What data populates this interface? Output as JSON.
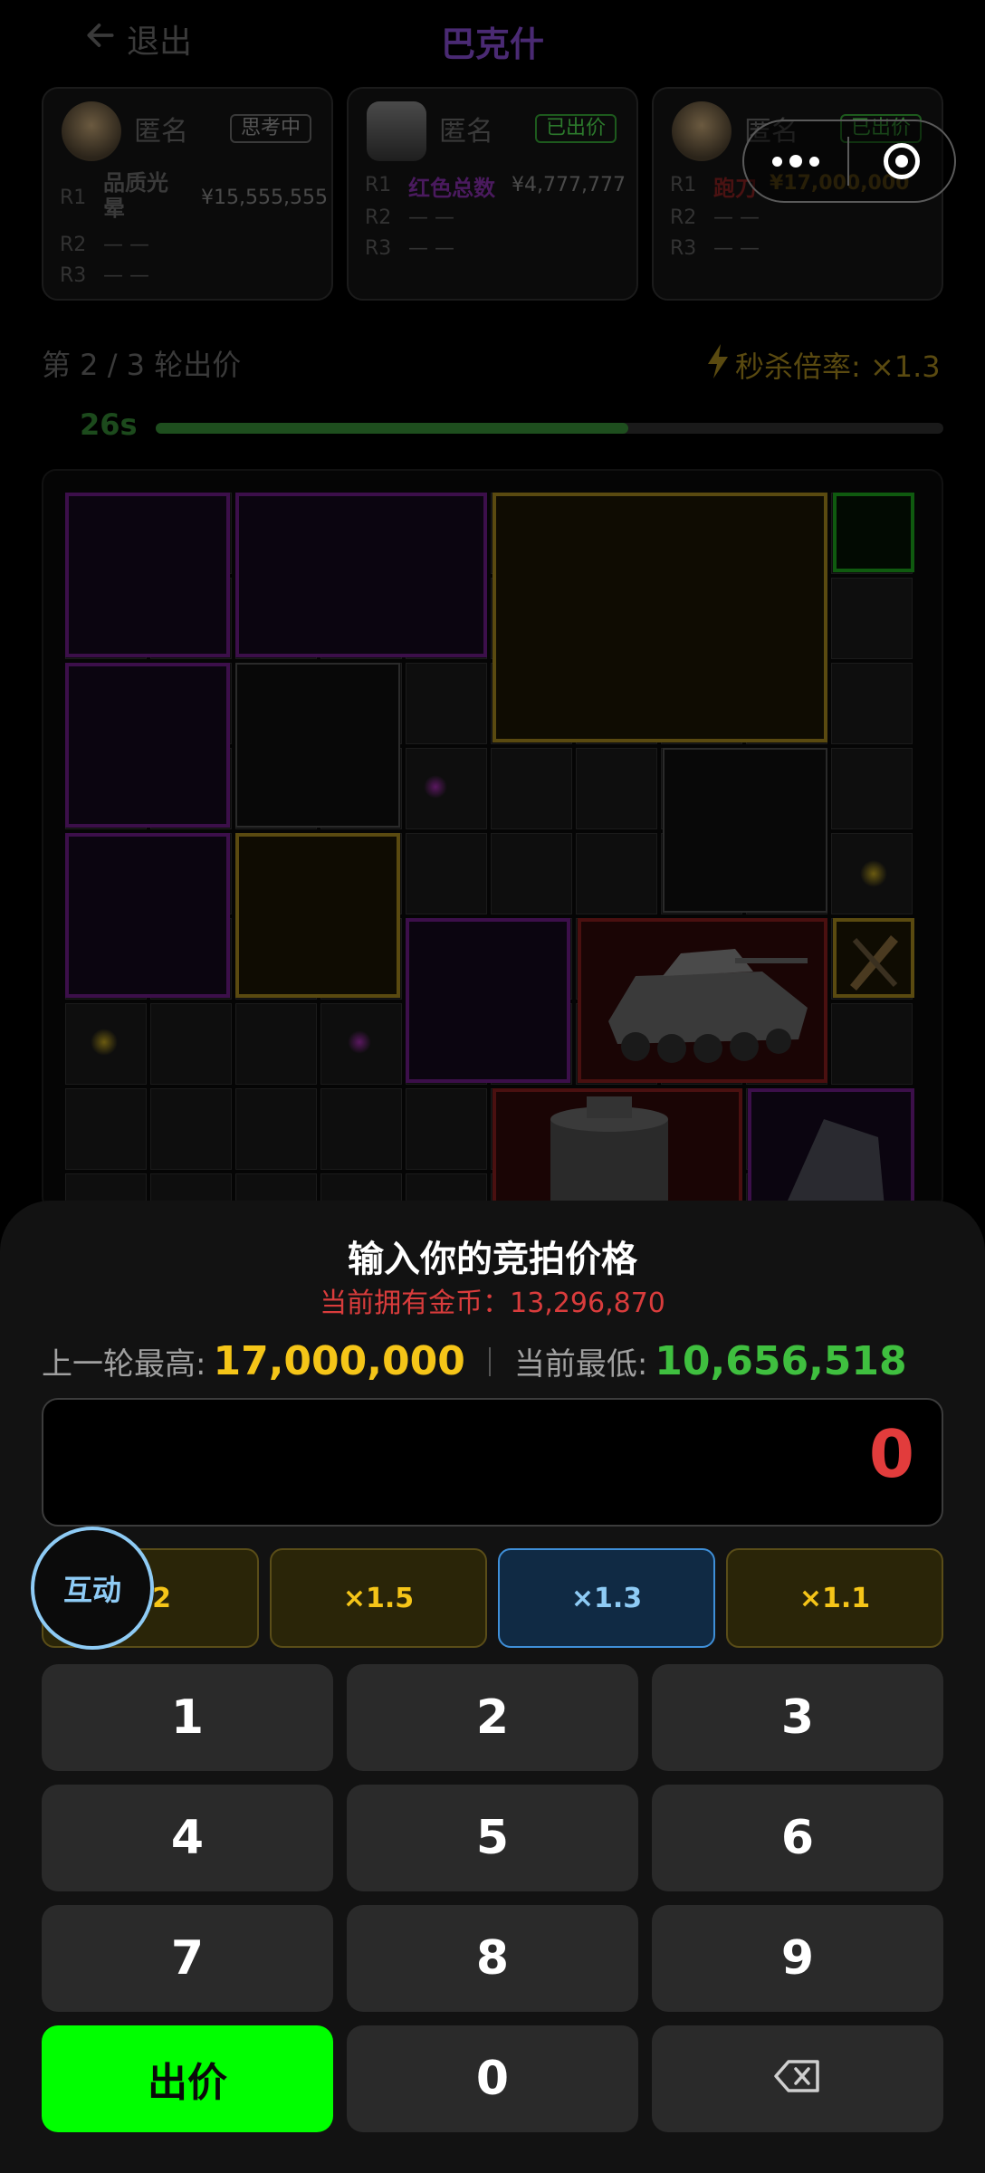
{
  "header": {
    "back_label": "退出",
    "title": "巴克什"
  },
  "players": [
    {
      "name": "匿名",
      "status": "思考中",
      "rounds": [
        {
          "label": "R1",
          "item": "品质光晕",
          "price": "¥15,555,555"
        },
        {
          "label": "R2",
          "item": "— —",
          "price": ""
        },
        {
          "label": "R3",
          "item": "— —",
          "price": ""
        }
      ]
    },
    {
      "name": "匿名",
      "status": "已出价",
      "rounds": [
        {
          "label": "R1",
          "item": "红色总数",
          "price": "¥4,777,777"
        },
        {
          "label": "R2",
          "item": "— —",
          "price": ""
        },
        {
          "label": "R3",
          "item": "— —",
          "price": ""
        }
      ]
    },
    {
      "name": "匿名",
      "status": "已出价",
      "rounds": [
        {
          "label": "R1",
          "item": "跑刀",
          "price": "¥17,000,000"
        },
        {
          "label": "R2",
          "item": "— —",
          "price": ""
        },
        {
          "label": "R3",
          "item": "— —",
          "price": ""
        }
      ]
    }
  ],
  "round_info": {
    "label": "第 2 / 3 轮出价",
    "instakill": "秒杀倍率: ×1.3"
  },
  "timer": {
    "label": "26s",
    "progress": 0.6
  },
  "colors": {
    "accent_green": "#00ff00",
    "gold": "#f5c518",
    "red": "#e23c3c",
    "blue": "#3f8fd8",
    "purple": "#8a2fbf"
  },
  "sheet": {
    "title": "输入你的竞拍价格",
    "coins": "当前拥有金币：13,296,870",
    "last_high_label": "上一轮最高:",
    "last_high_value": "17,000,000",
    "current_low_label": "当前最低:",
    "current_low_value": "10,656,518",
    "input_value": "0",
    "interact_label": "互动",
    "multipliers": [
      "×2",
      "×1.5",
      "×1.3",
      "×1.1"
    ],
    "keys": [
      "1",
      "2",
      "3",
      "4",
      "5",
      "6",
      "7",
      "8",
      "9",
      "出价",
      "0",
      "⌫"
    ],
    "backspace_icon": "backspace-icon"
  }
}
